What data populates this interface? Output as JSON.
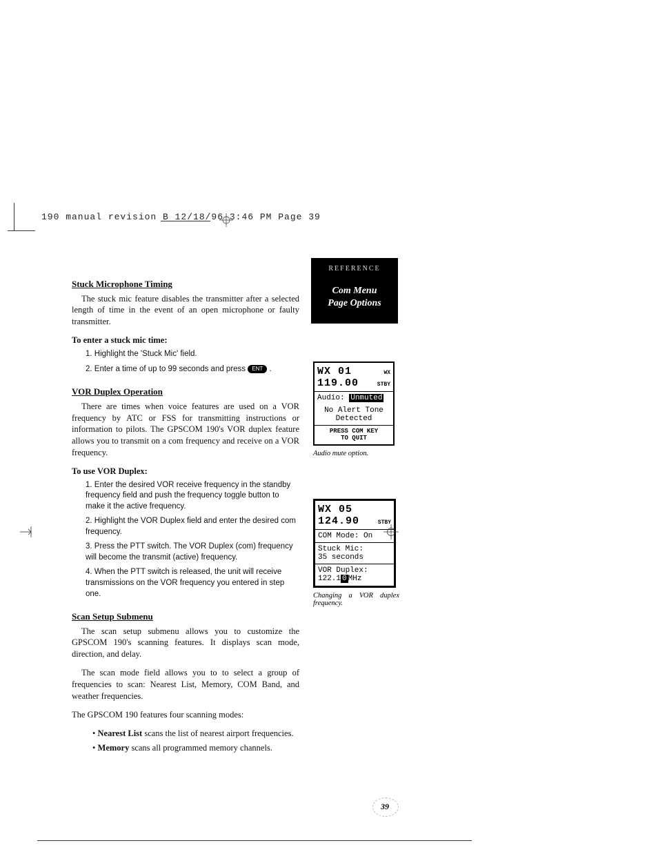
{
  "header": "190 manual revision B  12/18/96 3:46  PM   Page 39",
  "sidebar": {
    "reference": "REFERENCE",
    "title_l1": "Com Menu",
    "title_l2": "Page Options"
  },
  "sec1": {
    "heading": "Stuck Microphone Timing",
    "p1": "The stuck mic feature disables the transmitter after a selected length of time in the event of an open microphone or faulty transmitter.",
    "sub": "To enter a stuck mic time:",
    "s1": "1. Highlight the 'Stuck Mic' field.",
    "s2a": "2. Enter a time of up to 99 seconds and press ",
    "s2btn": "ENT",
    "s2b": " ."
  },
  "sec2": {
    "heading": "VOR Duplex Operation",
    "p1": "There are times when voice features are used on a VOR frequency by ATC or FSS for transmitting instructions or information to pilots. The GPSCOM 190's VOR duplex feature allows you to transmit on a com frequency and receive on a VOR frequency.",
    "sub": "To use VOR Duplex:",
    "s1": "1. Enter the desired VOR receive frequency in the standby frequency field and push the frequency toggle button to make it the active frequency.",
    "s2": "2. Highlight the VOR Duplex field and enter the desired com frequency.",
    "s3": "3. Press the PTT switch. The VOR Duplex (com) frequency will become the transmit (active) frequency.",
    "s4": "4. When the PTT switch is released, the unit will receive transmissions on the VOR frequency you entered in step one."
  },
  "sec3": {
    "heading": "Scan Setup Submenu",
    "p1": "The scan setup submenu allows you to customize the GPSCOM 190's scanning features. It displays scan mode, direction, and delay.",
    "p2": "The scan mode field allows you to to select a group of frequencies to scan: Nearest List, Memory, COM Band, and weather frequencies.",
    "p3": "The GPSCOM 190 features four scanning modes:",
    "b1a": "Nearest List",
    "b1b": " scans the list of nearest airport frequencies.",
    "b2a": "Memory",
    "b2b": " scans all programmed memory channels."
  },
  "fig1": {
    "r1a": "WX 01",
    "r1b": "WX",
    "r2a": "119.00",
    "r2b": "STBY",
    "r3a": "Audio: ",
    "r3b": "Unmuted",
    "r4": "No Alert Tone",
    "r5": "Detected",
    "r6": "PRESS COM KEY",
    "r7": "TO QUIT",
    "caption": "Audio mute option."
  },
  "fig2": {
    "r1": "WX 05",
    "r2a": "124.90",
    "r2b": "STBY",
    "r3": "COM Mode: On",
    "r4": "Stuck Mic:",
    "r5": " 35 seconds",
    "r6": "VOR Duplex:",
    "r7a": " 122.1",
    "r7b": "0",
    "r7c": "MHz",
    "caption": "Changing a VOR duplex frequency."
  },
  "page_number": "39"
}
